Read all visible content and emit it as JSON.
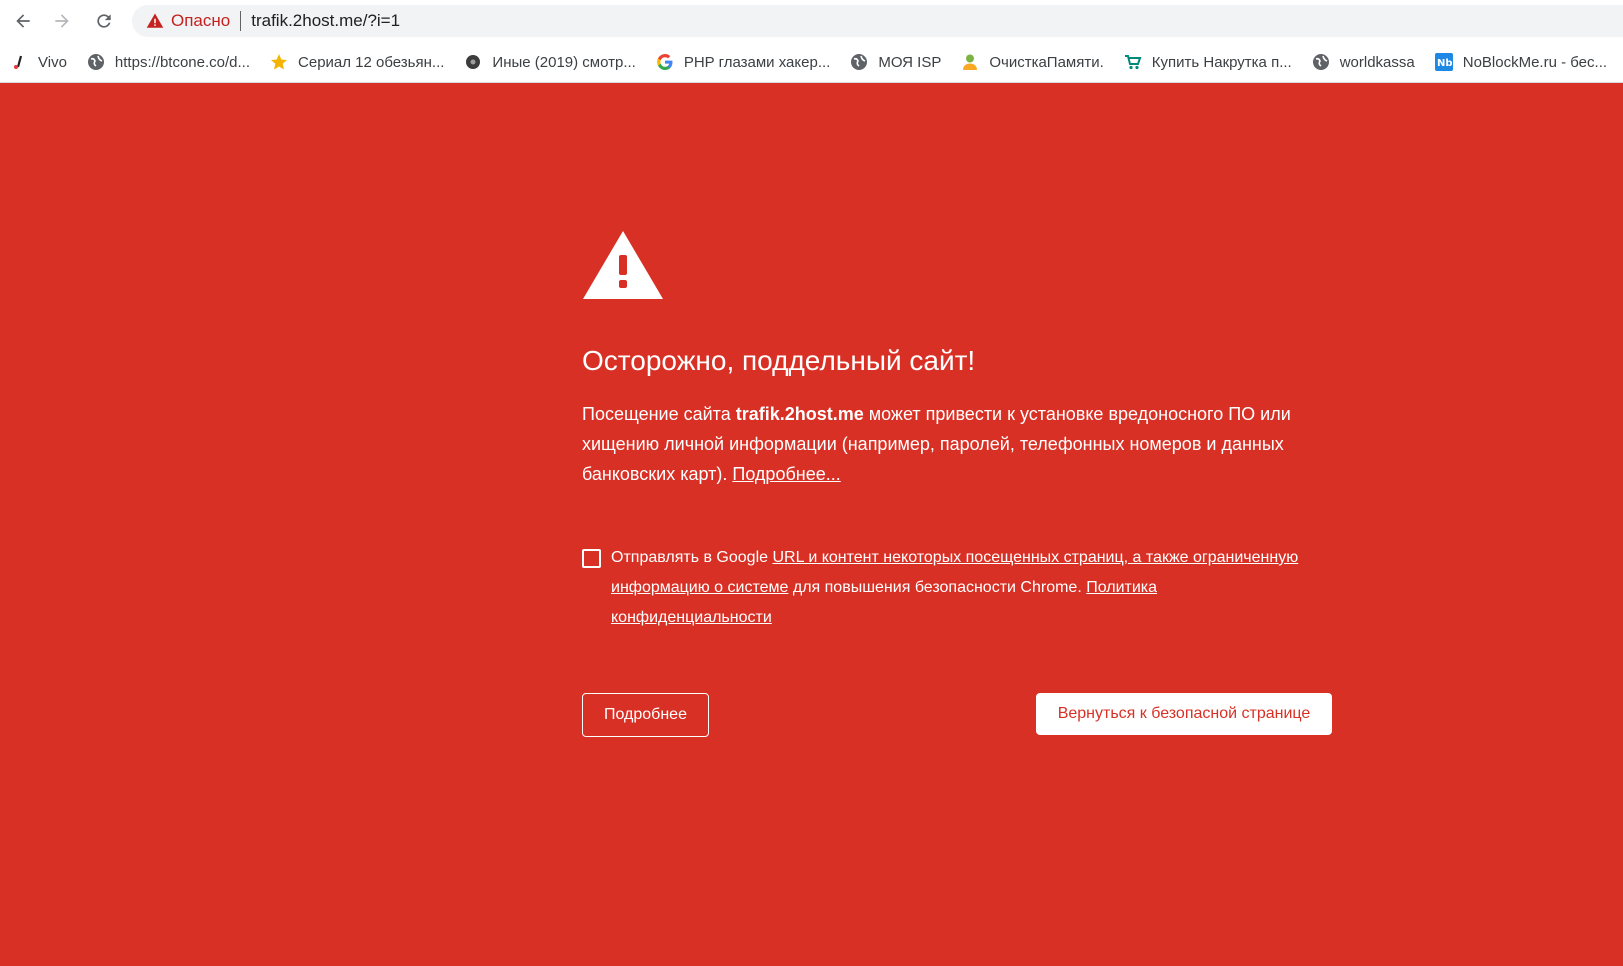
{
  "browser": {
    "security_status": "Опасно",
    "url": "trafik.2host.me/?i=1"
  },
  "bookmarks": [
    {
      "label": "Vivo",
      "icon": "vivo-icon"
    },
    {
      "label": "https://btcone.co/d...",
      "icon": "globe-icon"
    },
    {
      "label": "Сериал 12 обезьян...",
      "icon": "star-icon"
    },
    {
      "label": "Иные (2019) смотр...",
      "icon": "dark-circle-icon"
    },
    {
      "label": "PHP глазами хакер...",
      "icon": "google-icon"
    },
    {
      "label": "МОЯ ISP",
      "icon": "globe-icon"
    },
    {
      "label": "ОчисткаПамяти.",
      "icon": "user-icon"
    },
    {
      "label": "Купить Накрутка п...",
      "icon": "cart-icon"
    },
    {
      "label": "worldkassa",
      "icon": "globe-icon"
    },
    {
      "label": "NoBlockMe.ru - бес...",
      "icon": "nb-icon"
    }
  ],
  "interstitial": {
    "heading": "Осторожно, поддельный сайт!",
    "body_before": "Посещение сайта ",
    "site": "trafik.2host.me",
    "body_after": " может привести к установке вредоносного ПО или хищению личной информации (например, паролей, телефонных номеров и данных банковских карт). ",
    "details_link": "Подробнее...",
    "optin_prefix": "Отправлять в Google ",
    "optin_link1": "URL и контент некоторых посещенных страниц, а также ограниченную информацию о системе",
    "optin_middle": " для повышения безопасности Chrome. ",
    "optin_link2": "Политика конфиденциальности",
    "optin_checked": false,
    "details_button": "Подробнее",
    "back_button": "Вернуться к безопасной странице"
  },
  "colors": {
    "interstitial_bg": "#d93025",
    "danger_text": "#c5221f"
  }
}
